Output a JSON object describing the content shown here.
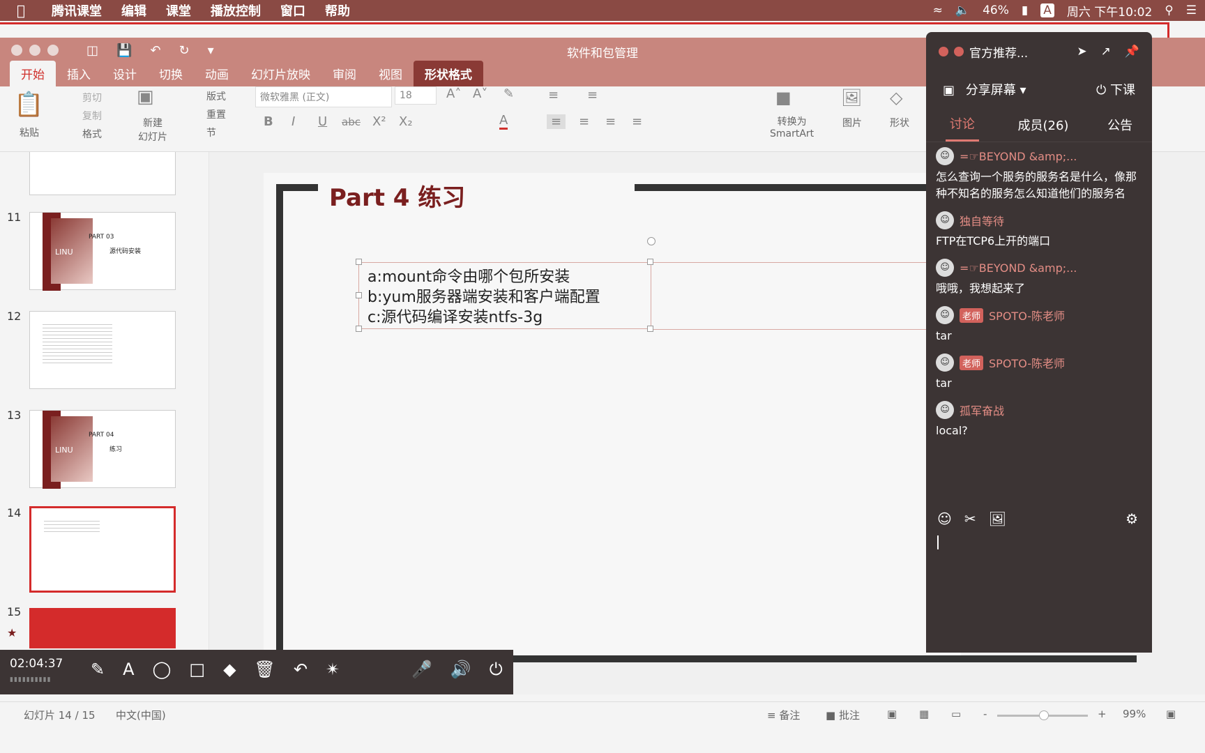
{
  "menubar": {
    "apple": "",
    "items": [
      "腾讯课堂",
      "编辑",
      "课堂",
      "播放控制",
      "窗口",
      "帮助"
    ],
    "battery": "46%",
    "input_method": "A",
    "clock": "周六 下午10:02"
  },
  "window": {
    "title": "软件和包管理"
  },
  "ribbon": {
    "tabs": [
      "开始",
      "插入",
      "设计",
      "切换",
      "动画",
      "幻灯片放映",
      "审阅",
      "视图",
      "形状格式"
    ],
    "paste": "粘贴",
    "cut": "剪切",
    "copy": "复制",
    "format": "格式",
    "new_slide": "新建\n幻灯片",
    "layout": "版式",
    "reset": "重置",
    "section": "节",
    "font_name": "微软雅黑 (正文)",
    "font_size": "18",
    "smartart": "转换为\nSmartArt",
    "picture": "图片",
    "shapes": "形状"
  },
  "thumbnails": {
    "numbers": [
      "11",
      "12",
      "13",
      "14",
      "15"
    ],
    "t11_part": "PART 03",
    "t11_title": "源代码安装",
    "t13_part": "PART 04",
    "t13_title": "练习",
    "t_linux": "LINU"
  },
  "slide": {
    "title": "Part 4 练习",
    "lines": [
      "a:mount命令由哪个包所安装",
      "b:yum服务器端安装和客户端配置",
      "c:源代码编译安装ntfs-3g"
    ]
  },
  "chat": {
    "header_title": "官方推荐...",
    "share_screen": "分享屏幕",
    "end_class": "下课",
    "tabs": [
      "讨论",
      "成员(26)",
      "公告"
    ],
    "messages": [
      {
        "user": "=☞BEYOND &amp;...",
        "badge": "",
        "text": "怎么查询一个服务的服务名是什么，像那种不知名的服务怎么知道他们的服务名"
      },
      {
        "user": "独自等待",
        "badge": "",
        "text": "FTP在TCP6上开的端口"
      },
      {
        "user": "=☞BEYOND &amp;...",
        "badge": "",
        "text": "哦哦，我想起来了"
      },
      {
        "user": "SPOTO-陈老师",
        "badge": "老师",
        "text": "tar"
      },
      {
        "user": "SPOTO-陈老师",
        "badge": "老师",
        "text": "tar"
      },
      {
        "user": "孤军奋战",
        "badge": "",
        "text": "local?"
      }
    ]
  },
  "recorder": {
    "elapsed": "02:04:37"
  },
  "statusbar": {
    "slide_info": "幻灯片 14 / 15",
    "language": "中文(中国)",
    "notes": "备注",
    "comments": "批注",
    "zoom": "99%",
    "zoom_minus": "-",
    "zoom_plus": "+"
  },
  "colors": {
    "accent": "#d0312d",
    "chat_bg": "#3c3434",
    "title_color": "#7a1f1f"
  }
}
